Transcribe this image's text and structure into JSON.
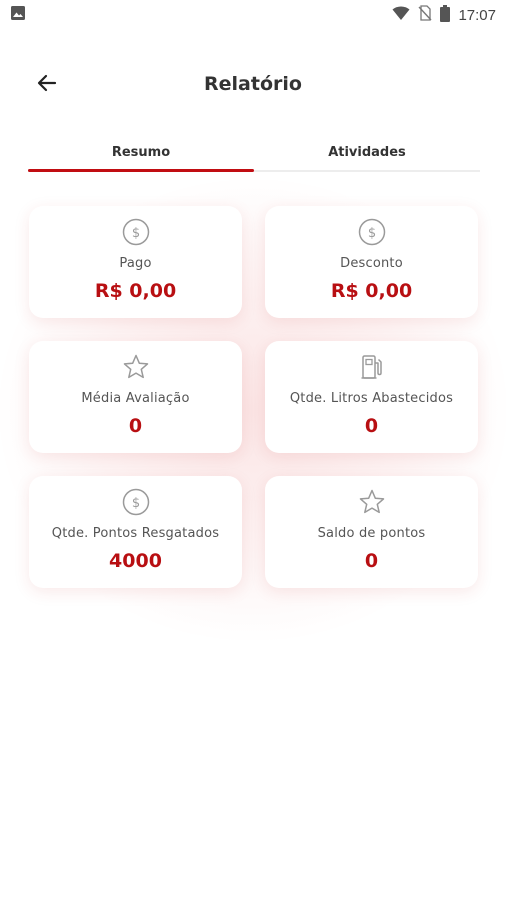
{
  "status_bar": {
    "time": "17:07",
    "icons": [
      "image-icon",
      "wifi-icon",
      "no-sim-icon",
      "battery-icon"
    ]
  },
  "header": {
    "title": "Relatório",
    "back_icon": "arrow-left-icon"
  },
  "tabs": [
    {
      "label": "Resumo",
      "active": true
    },
    {
      "label": "Atividades",
      "active": false
    }
  ],
  "cards": [
    {
      "icon": "dollar-circle-icon",
      "label": "Pago",
      "value": "R$ 0,00"
    },
    {
      "icon": "dollar-circle-icon",
      "label": "Desconto",
      "value": "R$ 0,00"
    },
    {
      "icon": "star-icon",
      "label": "Média Avaliação",
      "value": "0"
    },
    {
      "icon": "fuel-pump-icon",
      "label": "Qtde. Litros Abastecidos",
      "value": "0"
    },
    {
      "icon": "dollar-circle-icon",
      "label": "Qtde. Pontos Resgatados",
      "value": "4000"
    },
    {
      "icon": "star-icon",
      "label": "Saldo de pontos",
      "value": "0"
    }
  ],
  "colors": {
    "accent": "#c10d12",
    "value_text": "#b80f12",
    "icon_gray": "#9a9a9a"
  }
}
